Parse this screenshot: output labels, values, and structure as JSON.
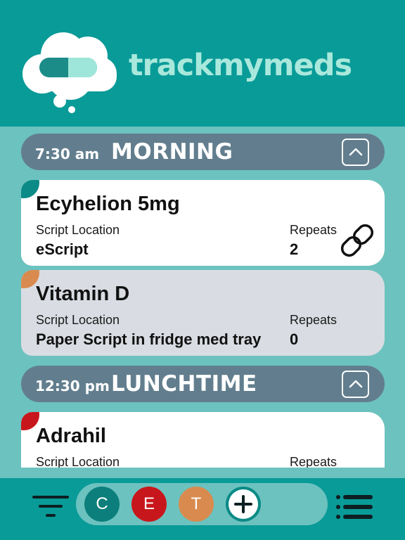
{
  "app": {
    "brand_parts": [
      "track",
      "my",
      "meds"
    ],
    "colors": {
      "header": "#099b98",
      "background": "#6cc2bf",
      "section": "#627e8e",
      "brand_text": "#a9e8dc",
      "card_white": "#ffffff",
      "card_grey": "#d9dde3"
    }
  },
  "sections": [
    {
      "time": "7:30 am",
      "name": "MORNING",
      "collapse_icon": "chevron-up-icon",
      "meds": [
        {
          "name": "Ecyhelion 5mg",
          "location_label": "Script Location",
          "location": "eScript",
          "repeats_label": "Repeats",
          "repeats": "2",
          "tag_color": "#0c8a87",
          "card_style": "white",
          "icon": "link-icon"
        },
        {
          "name": "Vitamin D",
          "location_label": "Script Location",
          "location": "Paper Script in fridge med tray",
          "repeats_label": "Repeats",
          "repeats": "0",
          "tag_color": "#d98b4f",
          "card_style": "grey"
        }
      ]
    },
    {
      "time": "12:30 pm",
      "name": "LUNCHTIME",
      "collapse_icon": "chevron-up-icon",
      "meds": [
        {
          "name": "Adrahil",
          "location_label": "Script Location",
          "repeats_label": "Repeats",
          "tag_color": "#c8171c",
          "card_style": "white"
        }
      ]
    }
  ],
  "bottom_bar": {
    "filter_icon": "filter-icon",
    "list_icon": "list-icon",
    "buttons": [
      {
        "label": "C",
        "color": "#0c7f7c"
      },
      {
        "label": "E",
        "color": "#c8171c"
      },
      {
        "label": "T",
        "color": "#d98b4f"
      }
    ],
    "add_icon": "plus-icon"
  }
}
